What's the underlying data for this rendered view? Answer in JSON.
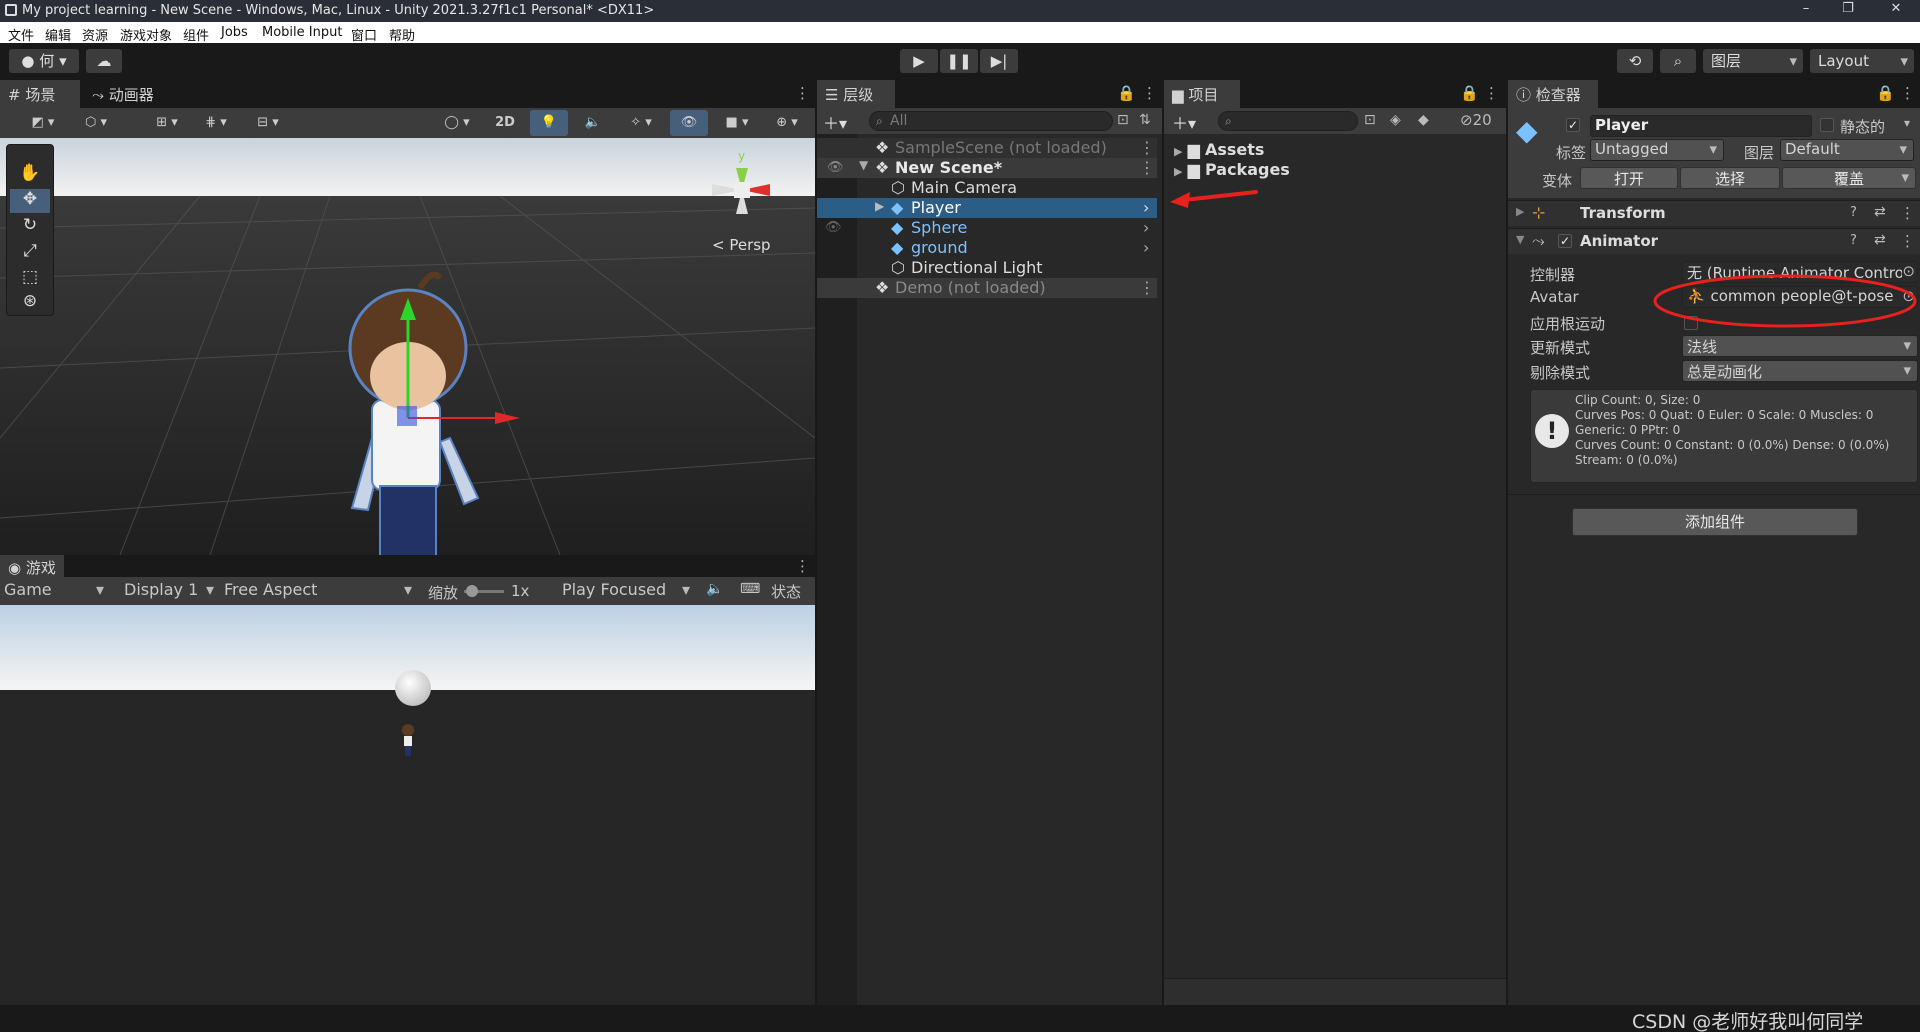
{
  "window": {
    "title": "My project learning - New Scene - Windows, Mac, Linux - Unity 2021.3.27f1c1 Personal* <DX11>",
    "minimize": "–",
    "maximize": "❐",
    "close": "✕"
  },
  "menu": [
    "文件",
    "编辑",
    "资源",
    "游戏对象",
    "组件",
    "Jobs",
    "Mobile Input",
    "窗口",
    "帮助"
  ],
  "toolbar": {
    "account_label": "何",
    "layers_label": "图层",
    "layout_label": "Layout"
  },
  "scene": {
    "tabs": [
      "场景",
      "动画器"
    ],
    "mode_2d": "2D",
    "persp_label": "< Persp",
    "axis_x": "x",
    "axis_y": "y"
  },
  "game": {
    "tab": "游戏",
    "view_select": "Game",
    "display_select": "Display 1",
    "aspect_select": "Free Aspect",
    "scale_label": "缩放",
    "scale_value": "1x",
    "play_mode": "Play Focused",
    "stats_label": "状态"
  },
  "hierarchy": {
    "tab": "层级",
    "search_placeholder": "All",
    "items": [
      {
        "label": "SampleScene (not loaded)",
        "type": "scene",
        "muted": true
      },
      {
        "label": "New Scene*",
        "type": "scene",
        "muted": false
      },
      {
        "label": "Main Camera",
        "type": "object"
      },
      {
        "label": "Player",
        "type": "prefab",
        "selected": true
      },
      {
        "label": "Sphere",
        "type": "prefab"
      },
      {
        "label": "ground",
        "type": "prefab"
      },
      {
        "label": "Directional Light",
        "type": "object"
      },
      {
        "label": "Demo (not loaded)",
        "type": "scene",
        "muted": true
      }
    ]
  },
  "project": {
    "tab": "项目",
    "hidden_count": "20",
    "folders": [
      "Assets",
      "Packages"
    ]
  },
  "inspector": {
    "tab": "检查器",
    "object_name": "Player",
    "static_label": "静态的",
    "tag_label": "标签",
    "tag_value": "Untagged",
    "layer_label": "图层",
    "layer_value": "Default",
    "prefab_label": "变体",
    "prefab_open": "打开",
    "prefab_select": "选择",
    "prefab_override": "覆盖",
    "transform_title": "Transform",
    "animator_title": "Animator",
    "controller_label": "控制器",
    "controller_value": "无 (Runtime Animator Contro",
    "avatar_label": "Avatar",
    "avatar_value": "common people@t-pose",
    "root_motion_label": "应用根运动",
    "update_mode_label": "更新模式",
    "update_mode_value": "法线",
    "culling_label": "剔除模式",
    "culling_value": "总是动画化",
    "info_lines": [
      "Clip Count: 0, Size: 0",
      "Curves Pos: 0 Quat: 0 Euler: 0 Scale: 0 Muscles: 0",
      "Generic: 0 PPtr: 0",
      "Curves Count: 0 Constant: 0 (0.0%) Dense: 0 (0.0%)",
      "Stream: 0 (0.0%)"
    ],
    "add_component": "添加组件"
  },
  "watermark": "CSDN @老师好我叫何同学",
  "colors": {
    "selection": "#2c5d87",
    "prefab_blue": "#7cc1ff",
    "annotation_red": "#e8211d"
  }
}
